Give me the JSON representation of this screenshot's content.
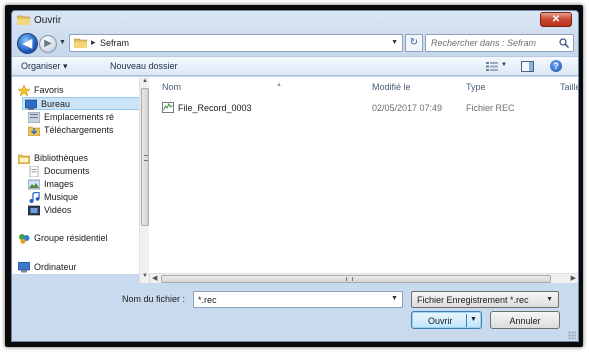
{
  "window": {
    "title": "Ouvrir",
    "close_label": "✕"
  },
  "address_bar": {
    "path_segments": [
      "Sefram"
    ]
  },
  "search": {
    "placeholder": "Rechercher dans : Sefram"
  },
  "toolbar": {
    "organize_label": "Organiser ▾",
    "new_folder_label": "Nouveau dossier"
  },
  "sidebar": {
    "groups": [
      {
        "label": "Favoris",
        "icon": "star-icon",
        "items": [
          {
            "label": "Bureau",
            "icon": "desktop-icon",
            "selected": true
          },
          {
            "label": "Emplacements ré",
            "icon": "recent-places-icon"
          },
          {
            "label": "Téléchargements",
            "icon": "downloads-icon"
          }
        ]
      },
      {
        "label": "Bibliothèques",
        "icon": "libraries-icon",
        "items": [
          {
            "label": "Documents",
            "icon": "documents-icon"
          },
          {
            "label": "Images",
            "icon": "images-icon"
          },
          {
            "label": "Musique",
            "icon": "music-icon"
          },
          {
            "label": "Vidéos",
            "icon": "videos-icon"
          }
        ]
      },
      {
        "label": "Groupe résidentiel",
        "icon": "homegroup-icon",
        "items": []
      },
      {
        "label": "Ordinateur",
        "icon": "computer-icon",
        "items": []
      }
    ]
  },
  "file_list": {
    "columns": [
      "Nom",
      "Modifié le",
      "Type",
      "Taille"
    ],
    "rows": [
      {
        "name": "File_Record_0003",
        "modified": "02/05/2017 07:49",
        "type": "Fichier REC",
        "icon": "rec-file-icon"
      }
    ]
  },
  "footer": {
    "filename_label": "Nom du fichier :",
    "filename_value": "*.rec",
    "filetype_value": "Fichier Enregistrement *.rec",
    "open_label": "Ouvrir",
    "cancel_label": "Annuler"
  }
}
